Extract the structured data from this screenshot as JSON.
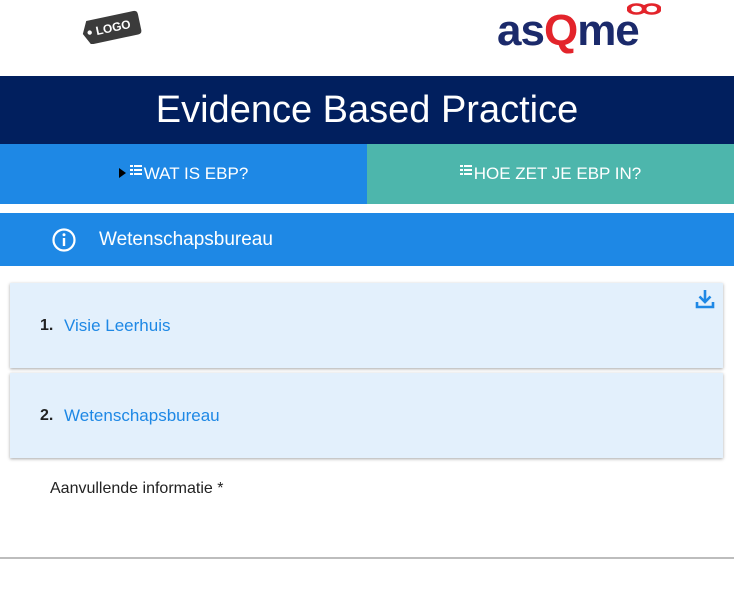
{
  "header": {
    "logo_text": "LOGO",
    "brand": {
      "part1": "as",
      "part2": "Q",
      "part3": "me"
    }
  },
  "title": "Evidence Based Practice",
  "tabs": [
    {
      "label": "WAT IS EBP?",
      "active": true
    },
    {
      "label": "HOE ZET JE EBP IN?",
      "active": false
    }
  ],
  "section": {
    "title": "Wetenschapsbureau",
    "icon": "info-icon"
  },
  "items": [
    {
      "number": "1.",
      "label": "Visie Leerhuis",
      "has_download": true
    },
    {
      "number": "2.",
      "label": "Wetenschapsbureau",
      "has_download": false
    }
  ],
  "extra": {
    "label": "Aanvullende informatie *"
  },
  "colors": {
    "title_bg": "#011f5e",
    "tab_primary": "#1e88e5",
    "tab_secondary": "#4db6ac",
    "item_bg": "#e3f0fc",
    "brand_red": "#e3242b"
  }
}
